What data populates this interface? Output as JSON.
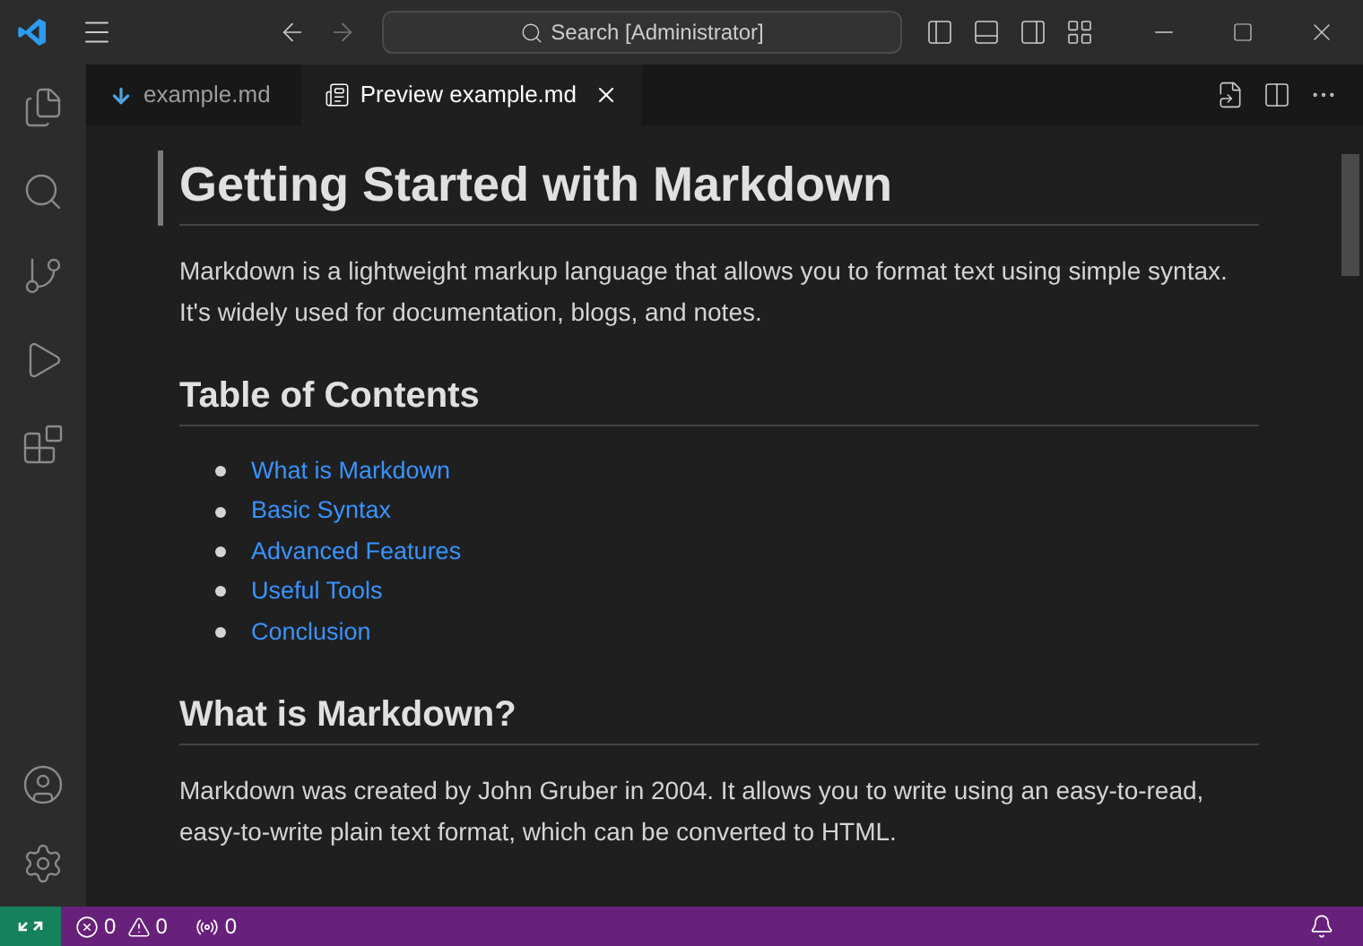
{
  "title_bar": {
    "search": "Search [Administrator]"
  },
  "activity_bar": {
    "items": [
      {
        "kind": "explorer",
        "selected": false
      },
      {
        "kind": "search",
        "selected": false
      },
      {
        "kind": "source-control",
        "selected": false
      },
      {
        "kind": "run",
        "selected": false
      },
      {
        "kind": "extensions",
        "selected": false
      }
    ]
  },
  "tabs": [
    {
      "kind": "markdown",
      "label": "example.md",
      "selected": false
    },
    {
      "kind": "preview",
      "label": "Preview example.md",
      "selected": true
    }
  ],
  "document": [
    {
      "kind": "h1",
      "text": "Getting Started with Markdown"
    },
    {
      "kind": "p",
      "text": "Markdown is a lightweight markup language that allows you to format text using simple syntax. It's widely used for documentation, blogs, and notes."
    },
    {
      "kind": "h2",
      "text": "Table of Contents"
    },
    {
      "kind": "ul",
      "items": [
        "What is Markdown",
        "Basic Syntax",
        "Advanced Features",
        "Useful Tools",
        "Conclusion"
      ]
    },
    {
      "kind": "h2",
      "text": "What is Markdown?"
    },
    {
      "kind": "p",
      "text": "Markdown was created by John Gruber in 2004. It allows you to write using an easy-to-read, easy-to-write plain text format, which can be converted to HTML."
    }
  ],
  "status_bar": {
    "errors": "0",
    "warnings": "0",
    "ports": "0"
  }
}
